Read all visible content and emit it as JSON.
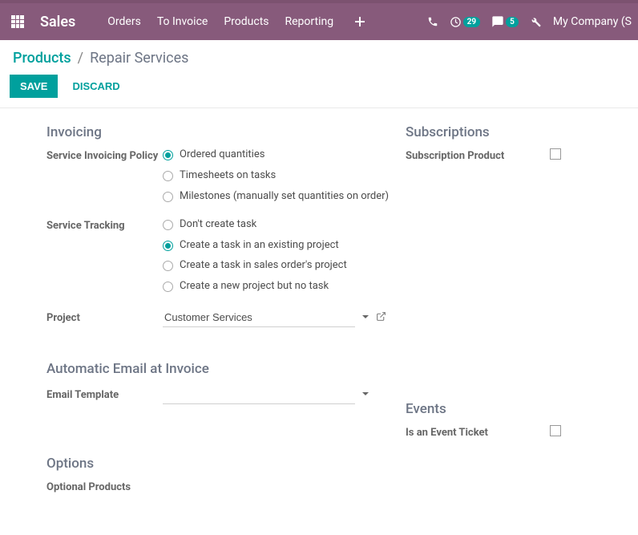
{
  "topbar": {
    "brand": "Sales",
    "nav": [
      "Orders",
      "To Invoice",
      "Products",
      "Reporting"
    ],
    "badge1": "29",
    "badge2": "5",
    "company": "My Company (S"
  },
  "breadcrumb": {
    "root": "Products",
    "current": "Repair Services"
  },
  "actions": {
    "save": "SAVE",
    "discard": "DISCARD"
  },
  "invoicing": {
    "title": "Invoicing",
    "policy_label": "Service Invoicing Policy",
    "policy_opts": [
      "Ordered quantities",
      "Timesheets on tasks",
      "Milestones (manually set quantities on order)"
    ],
    "tracking_label": "Service Tracking",
    "tracking_opts": [
      "Don't create task",
      "Create a task in an existing project",
      "Create a task in sales order's project",
      "Create a new project but no task"
    ],
    "project_label": "Project",
    "project_value": "Customer Services"
  },
  "subscriptions": {
    "title": "Subscriptions",
    "product_label": "Subscription Product"
  },
  "autoemail": {
    "title": "Automatic Email at Invoice",
    "template_label": "Email Template",
    "template_value": ""
  },
  "events": {
    "title": "Events",
    "ticket_label": "Is an Event Ticket"
  },
  "options": {
    "title": "Options",
    "optional_label": "Optional Products"
  }
}
